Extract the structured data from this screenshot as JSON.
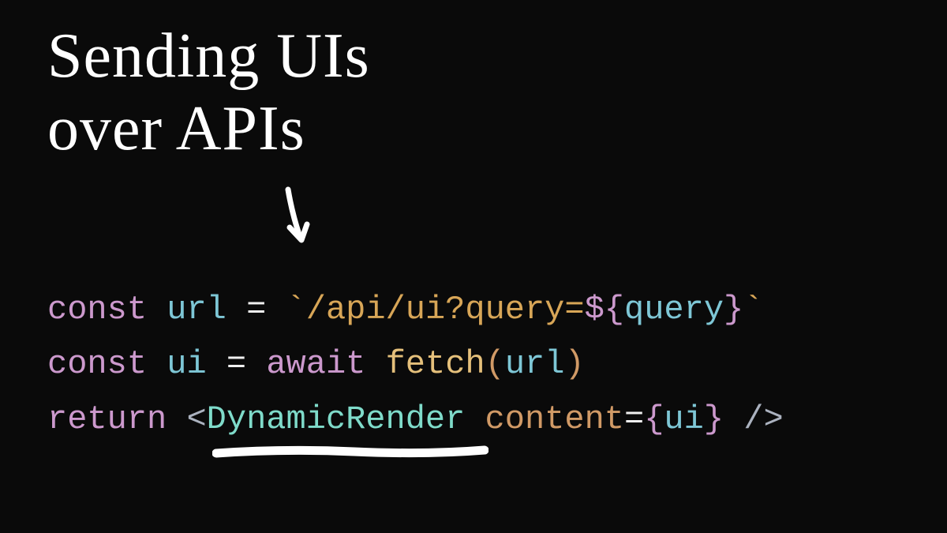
{
  "title": {
    "line1": "Sending UIs",
    "line2": "over APIs"
  },
  "code": {
    "line1": {
      "kw": "const",
      "var": "url",
      "eq": "=",
      "str_open": "`/api/ui?query=",
      "interp_open": "${",
      "interp_var": "query",
      "interp_close": "}",
      "str_close": "`"
    },
    "line2": {
      "kw": "const",
      "var": "ui",
      "eq": "=",
      "await": "await",
      "fn": "fetch",
      "lparen": "(",
      "arg": "url",
      "rparen": ")"
    },
    "line3": {
      "kw": "return",
      "lt": "<",
      "comp": "DynamicRender",
      "attr": "content",
      "eq": "=",
      "lbrace": "{",
      "val": "ui",
      "rbrace": "}",
      "close": "/>"
    }
  },
  "colors": {
    "background": "#0a0a0a",
    "title": "#ffffff",
    "keyword": "#cc99cd",
    "variable": "#7ec7d6",
    "string": "#d8a657",
    "function": "#e5c07b",
    "component": "#7fdbca",
    "attribute": "#d19a66",
    "punctuation": "#abb2bf"
  }
}
